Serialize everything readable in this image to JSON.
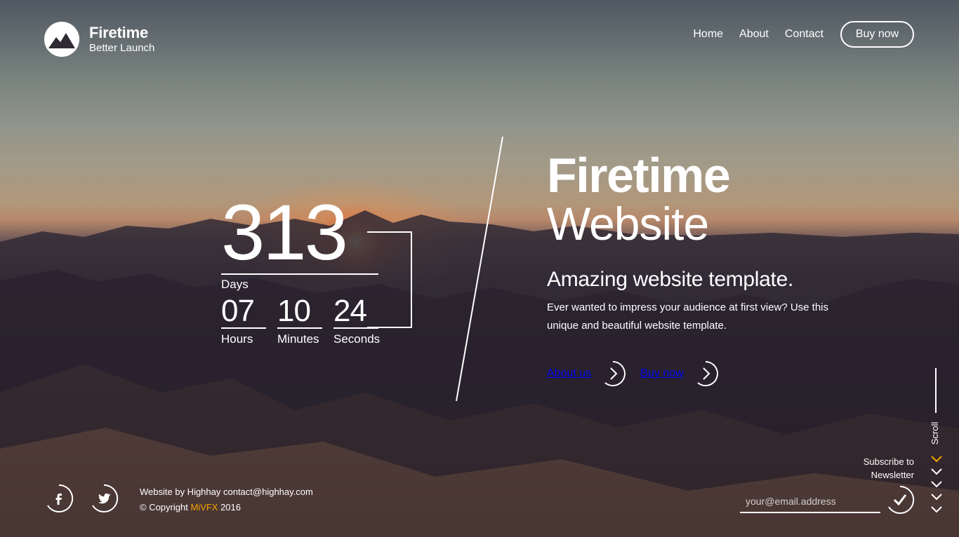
{
  "brand": {
    "name": "Firetime",
    "tagline": "Better Launch"
  },
  "nav": {
    "items": [
      {
        "label": "Home"
      },
      {
        "label": "About"
      },
      {
        "label": "Contact"
      }
    ],
    "cta_label": "Buy now"
  },
  "countdown": {
    "days": {
      "value": "313",
      "label": "Days"
    },
    "hours": {
      "value": "07",
      "label": "Hours"
    },
    "minutes": {
      "value": "10",
      "label": "Minutes"
    },
    "seconds": {
      "value": "24",
      "label": "Seconds"
    }
  },
  "hero": {
    "title": "Firetime",
    "subtitle": "Website",
    "tagline": "Amazing website template.",
    "description": "Ever wanted to impress your audience at first view? Use this unique and beautiful website template.",
    "links": [
      {
        "label": "About us",
        "icon": "chevron-right-circle-icon"
      },
      {
        "label": "Buy now",
        "icon": "chevron-right-circle-icon"
      }
    ]
  },
  "footer": {
    "social": [
      {
        "icon": "facebook-icon"
      },
      {
        "icon": "twitter-icon"
      }
    ],
    "credit_line": "Website by Highhay contact@highhay.com",
    "copyright_prefix": "© Copyright",
    "copyright_brand": "MiVFX",
    "copyright_year": "2016"
  },
  "newsletter": {
    "label_line1": "Subscribe to",
    "label_line2": "Newsletter",
    "placeholder": "your@email.address",
    "submit_icon": "checkmark-icon"
  },
  "scroll": {
    "label": "Scroll"
  },
  "colors": {
    "accent": "#f4a300",
    "text": "#ffffff"
  }
}
